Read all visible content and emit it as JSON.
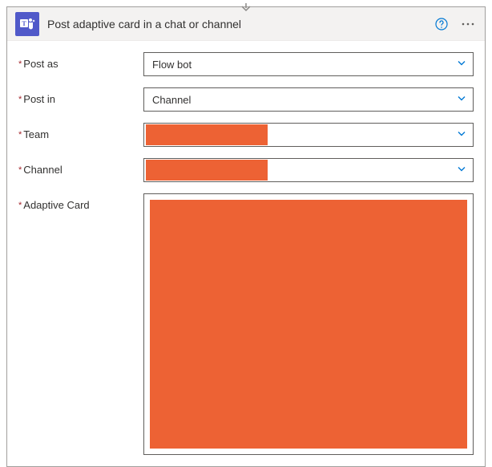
{
  "header": {
    "title": "Post adaptive card in a chat or channel"
  },
  "fields": {
    "postAs": {
      "label": "Post as",
      "value": "Flow bot"
    },
    "postIn": {
      "label": "Post in",
      "value": "Channel"
    },
    "team": {
      "label": "Team",
      "value": ""
    },
    "channel": {
      "label": "Channel",
      "value": ""
    },
    "adaptiveCard": {
      "label": "Adaptive Card",
      "value": ""
    }
  },
  "colors": {
    "brand": "#5059C9",
    "redacted": "#ED6234",
    "chevron": "#0078D4"
  }
}
